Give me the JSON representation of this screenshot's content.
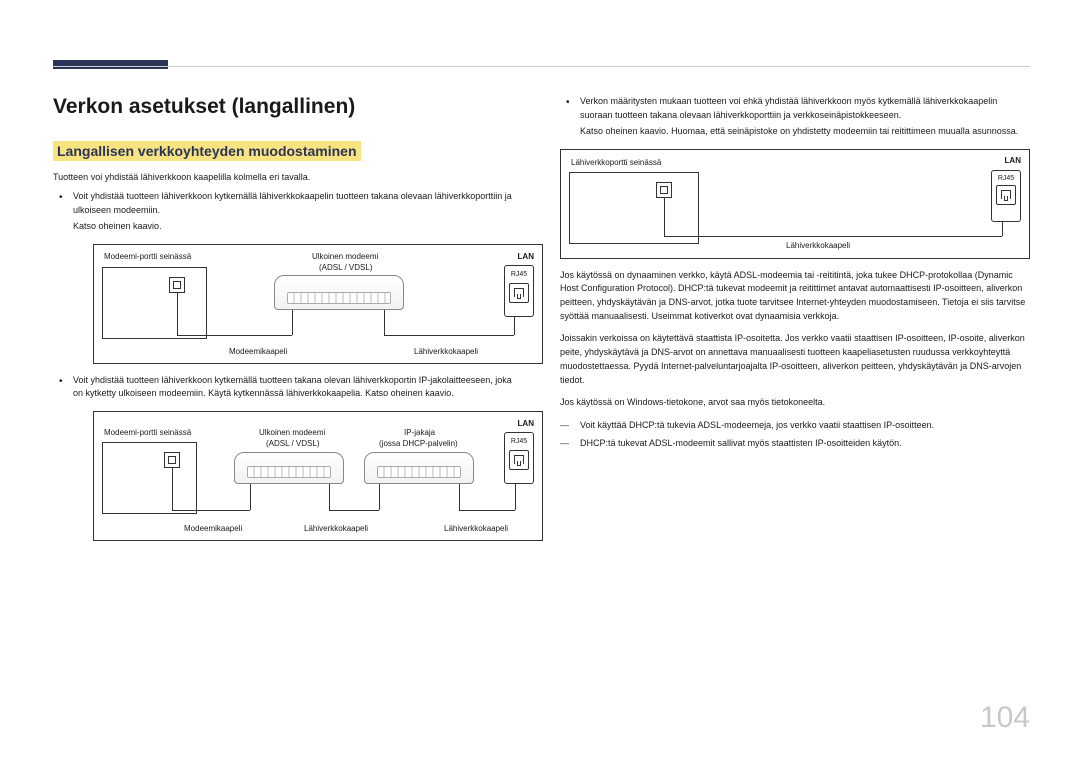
{
  "page": {
    "number": "104"
  },
  "left": {
    "h1": "Verkon asetukset (langallinen)",
    "h2": "Langallisen verkkoyhteyden muodostaminen",
    "intro": "Tuotteen voi yhdistää lähiverkkoon kaapelilla kolmella eri tavalla.",
    "b1": "Voit yhdistää tuotteen lähiverkkoon kytkemällä lähiverkkokaapelin tuotteen takana olevaan lähiverkkoporttiin ja ulkoiseen modeemiin.",
    "b1s": "Katso oheinen kaavio.",
    "b2": "Voit yhdistää tuotteen lähiverkkoon kytkemällä tuotteen takana olevan lähiverkkoportin IP-jakolaitteeseen, joka on kytketty ulkoiseen modeemiin. Käytä kytkennässä lähiverkkokaapelia. Katso oheinen kaavio.",
    "d1": {
      "wall": "Modeemi-portti seinässä",
      "modem1": "Ulkoinen modeemi",
      "modem1b": "(ADSL / VDSL)",
      "lan": "LAN",
      "rj45": "RJ45",
      "cable_modem": "Modeemikaapeli",
      "cable_lan": "Lähiverkkokaapeli"
    },
    "d2": {
      "wall": "Modeemi-portti seinässä",
      "modem1": "Ulkoinen modeemi",
      "modem1b": "(ADSL / VDSL)",
      "splitter": "IP-jakaja",
      "splitterb": "(jossa DHCP-palvelin)",
      "lan": "LAN",
      "rj45": "RJ45",
      "cable_modem": "Modeemikaapeli",
      "cable_lan1": "Lähiverkkokaapeli",
      "cable_lan2": "Lähiverkkokaapeli"
    }
  },
  "right": {
    "b1": "Verkon määritysten mukaan tuotteen voi ehkä yhdistää lähiverkkoon myös kytkemällä lähiverkkokaapelin suoraan tuotteen takana olevaan lähiverkkoporttiin ja verkkoseinäpistokkeeseen.",
    "b1s": "Katso oheinen kaavio. Huomaa, että seinäpistoke on yhdistetty modeemiin tai reitittimeen muualla asunnossa.",
    "d3": {
      "wall": "Lähiverkkoportti seinässä",
      "lan": "LAN",
      "rj45": "RJ45",
      "cable_lan": "Lähiverkkokaapeli"
    },
    "p1": "Jos käytössä on dynaaminen verkko, käytä ADSL-modeemia tai -reititintä, joka tukee DHCP-protokollaa (Dynamic Host Configuration Protocol). DHCP:tä tukevat modeemit ja reitittimet antavat automaattisesti IP-osoitteen, aliverkon peitteen, yhdyskäytävän ja DNS-arvot, jotka tuote tarvitsee Internet-yhteyden muodostamiseen. Tietoja ei siis tarvitse syöttää manuaalisesti. Useimmat kotiverkot ovat dynaamisia verkkoja.",
    "p2": "Joissakin verkoissa on käytettävä staattista IP-osoitetta. Jos verkko vaatii staattisen IP-osoitteen, IP-osoite, aliverkon peite, yhdyskäytävä ja DNS-arvot on annettava manuaalisesti tuotteen kaapeliasetusten ruudussa verkkoyhteyttä muodostettaessa. Pyydä Internet-palveluntarjoajalta IP-osoitteen, aliverkon peitteen, yhdyskäytävän ja DNS-arvojen tiedot.",
    "p3": "Jos käytössä on Windows-tietokone, arvot saa myös tietokoneelta.",
    "dash1": "Voit käyttää DHCP:tä tukevia ADSL-modeemeja, jos verkko vaatii staattisen IP-osoitteen.",
    "dash2": "DHCP:tä tukevat ADSL-modeemit sallivat myös staattisten IP-osoitteiden käytön."
  }
}
